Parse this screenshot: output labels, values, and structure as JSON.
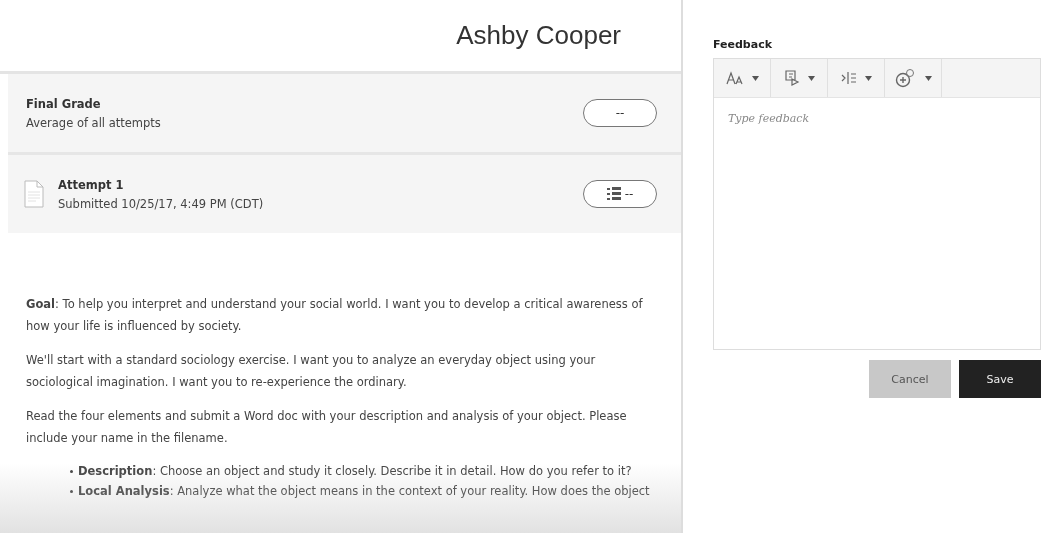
{
  "header": {
    "student_name": "Ashby Cooper"
  },
  "final_grade": {
    "title": "Final Grade",
    "subtitle": "Average of all attempts",
    "grade": "--"
  },
  "attempts": [
    {
      "title": "Attempt 1",
      "submitted": "Submitted 10/25/17, 4:49 PM (CDT)",
      "grade": "--"
    }
  ],
  "paragraphs": [
    "**Goal**: To help you interpret and understand your social world. I want you to develop a critical awareness of how your life is influenced by society.",
    "We'll start with a standard sociology exercise. I want you to analyze an everyday object using your sociological imagination. I want you to re-experience the ordinary.",
    "Read the four elements and submit a Word doc with your description and analysis of your object. Please include your name in the filename."
  ],
  "bullets": [
    "**Description**: Choose an object and study it closely. Describe it in detail. How do you refer to it?",
    "**Local Analysis**: Analyze what the object means in the context of your reality. How does the object"
  ],
  "feedback": {
    "label": "Feedback",
    "toolbar": [
      {
        "kind": "font-size"
      },
      {
        "kind": "paragraph"
      },
      {
        "kind": "align"
      },
      {
        "kind": "insert"
      }
    ],
    "placeholder": "Type feedback",
    "buttons": [
      {
        "kind": "secondary",
        "label": "Cancel"
      },
      {
        "kind": "primary",
        "label": "Save"
      }
    ]
  }
}
